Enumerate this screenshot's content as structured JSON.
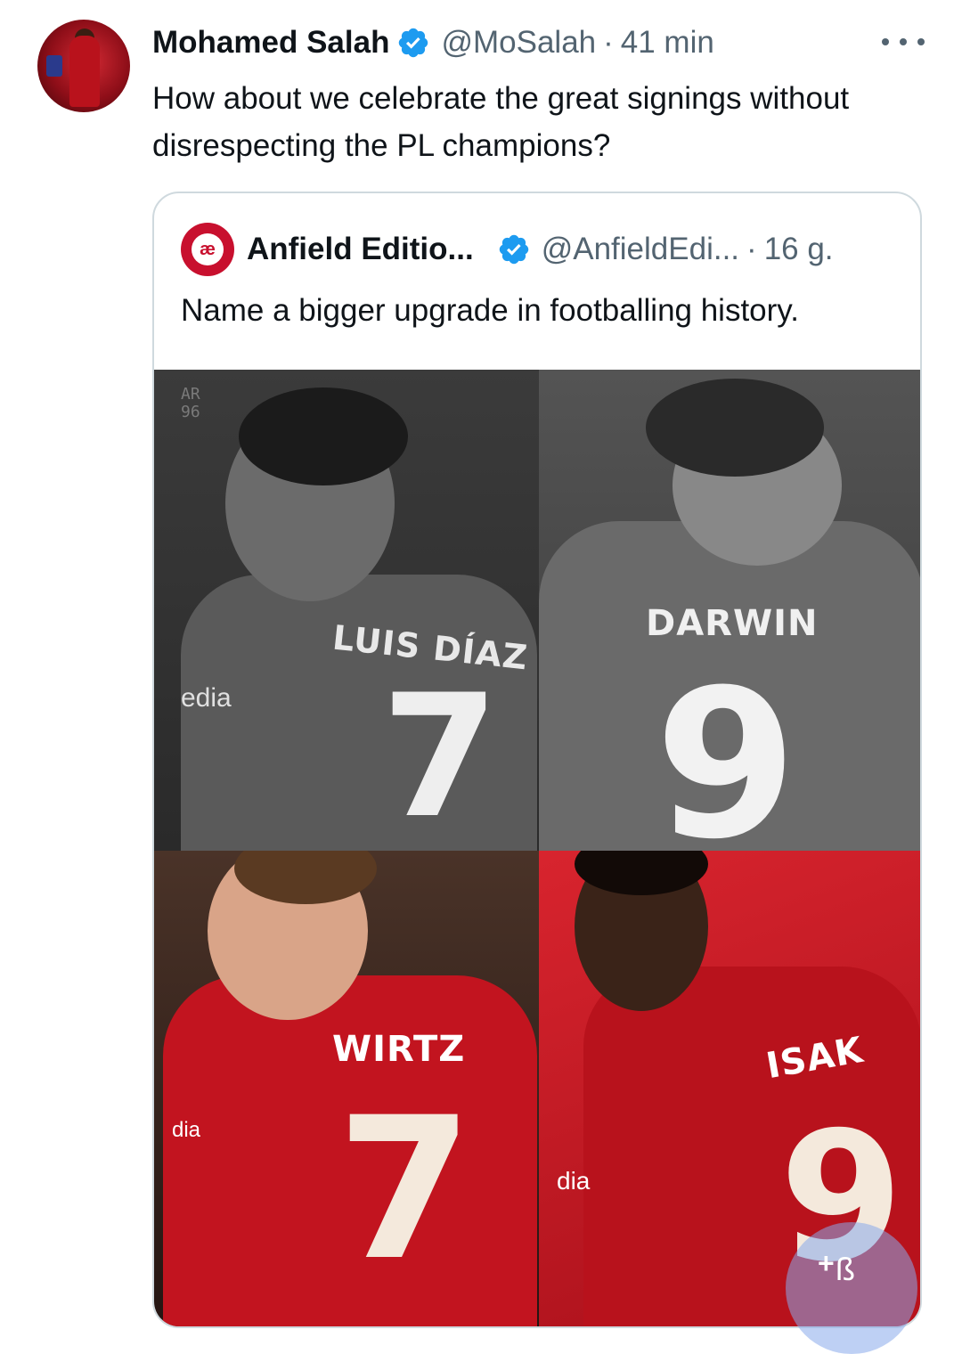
{
  "tweet": {
    "author_name": "Mohamed Salah",
    "handle": "@MoSalah",
    "separator": "·",
    "time": "41 min",
    "text": "How about we celebrate the great signings without disrespecting the PL champions?"
  },
  "quote": {
    "avatar_text": "æ",
    "author_name": "Anfield Editio...",
    "handle": "@AnfieldEdi...",
    "separator": "·",
    "time": "16 g.",
    "text": "Name a bigger upgrade in footballing history."
  },
  "image": {
    "watermark": "AR\n96",
    "players": [
      {
        "name": "LUIS DÍAZ",
        "number": "7",
        "sponsor": "edia"
      },
      {
        "name": "DARWIN",
        "number": "9",
        "sponsor": ""
      },
      {
        "name": "WIRTZ",
        "number": "7",
        "sponsor": "dia"
      },
      {
        "name": "ISAK",
        "number": "9",
        "sponsor": "dia"
      }
    ]
  },
  "colors": {
    "verified_blue": "#1d9bf0",
    "secondary_text": "#536471",
    "border": "#cfd9de",
    "liverpool_red": "#c8102e"
  },
  "icons": [
    "verified-badge-icon",
    "more-options-icon",
    "compose-plus-icon"
  ]
}
